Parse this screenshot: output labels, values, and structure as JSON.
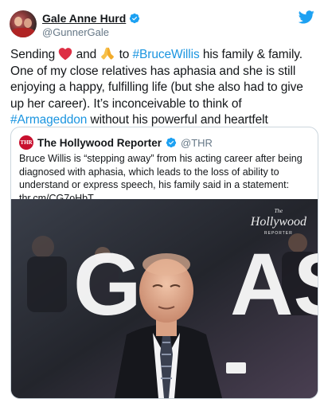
{
  "tweet": {
    "display_name": "Gale Anne Hurd",
    "handle": "@GunnerGale",
    "text": {
      "p1": "Sending",
      "p2": " and ",
      "p3": " to ",
      "hashtag1": "#BruceWillis",
      "p4": " his family & family. One of my close relatives has aphasia and she is still enjoying a happy, fulfilling life (but she also had to give up her career). It’s inconceivable to think of ",
      "hashtag2": "#Armageddon",
      "p5": " without his powerful and heartfelt performance."
    },
    "emojis": [
      "red-heart",
      "folded-hands"
    ]
  },
  "quote": {
    "logo_text": "THR",
    "name": "The Hollywood Reporter",
    "handle": "@THR",
    "text": "Bruce Willis is “stepping away” from his acting career after being diagnosed with aphasia, which leads to the loss of ability to understand or express speech, his family said in a statement: thr.cm/CG7oHbT",
    "photo": {
      "backdrop_letters": "G  AS",
      "watermark_top": "The",
      "watermark_main": "Hollywood",
      "watermark_sub": "REPORTER"
    }
  },
  "colors": {
    "link": "#1b95e0",
    "verified": "#1da1f2",
    "heart": "#e0245e",
    "thr_red": "#c8102e"
  },
  "icons": [
    "verified-badge-icon",
    "twitter-bird-icon",
    "verified-badge-icon"
  ]
}
